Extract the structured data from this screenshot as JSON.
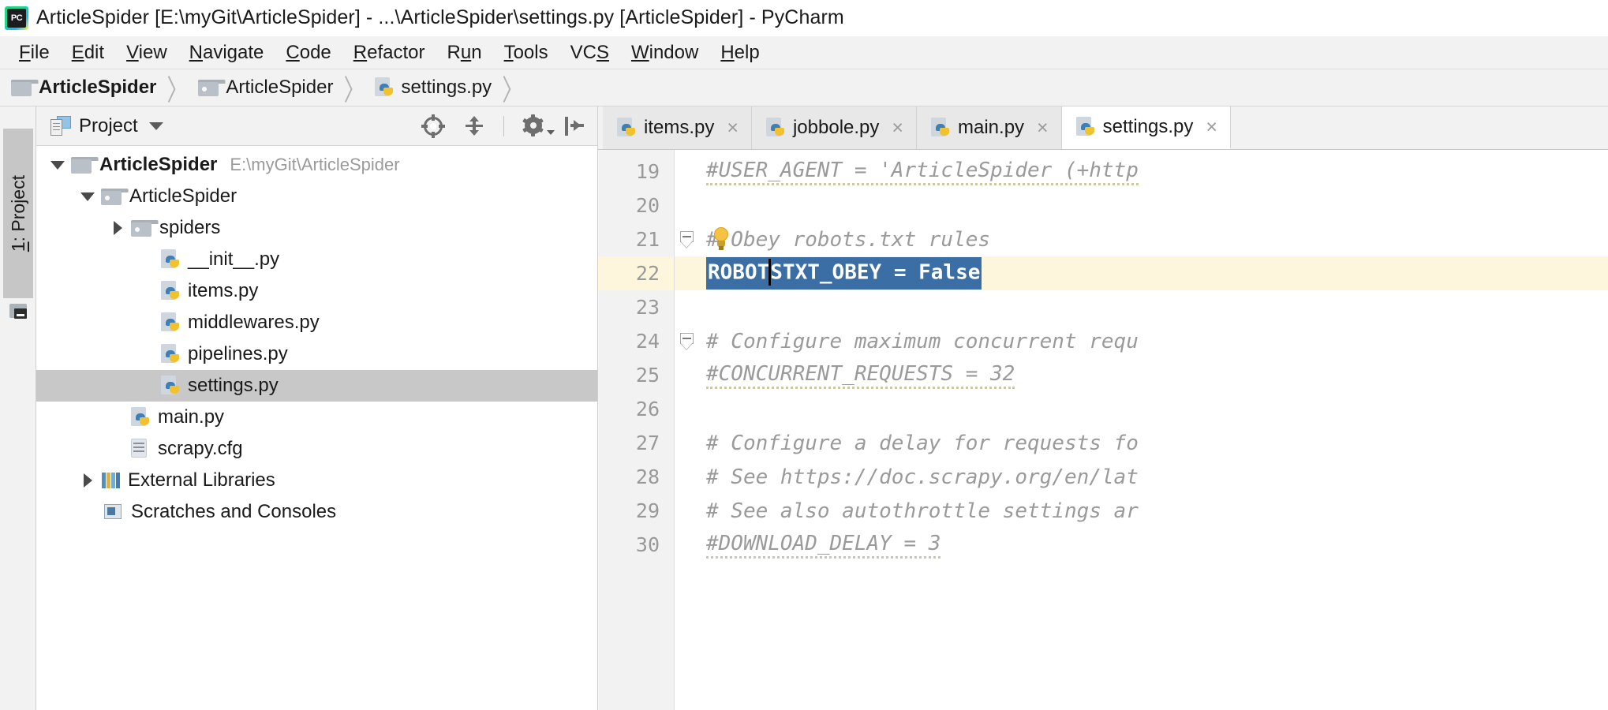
{
  "window": {
    "title": "ArticleSpider [E:\\myGit\\ArticleSpider] - ...\\ArticleSpider\\settings.py [ArticleSpider] - PyCharm",
    "app_icon": "pycharm-logo-icon",
    "logo_text": "PC"
  },
  "menubar": {
    "items": [
      {
        "label": "File",
        "mnemonic": "F"
      },
      {
        "label": "Edit",
        "mnemonic": "E"
      },
      {
        "label": "View",
        "mnemonic": "V"
      },
      {
        "label": "Navigate",
        "mnemonic": "N"
      },
      {
        "label": "Code",
        "mnemonic": "C"
      },
      {
        "label": "Refactor",
        "mnemonic": "R"
      },
      {
        "label": "Run",
        "mnemonic": "u"
      },
      {
        "label": "Tools",
        "mnemonic": "T"
      },
      {
        "label": "VCS",
        "mnemonic": "S"
      },
      {
        "label": "Window",
        "mnemonic": "W"
      },
      {
        "label": "Help",
        "mnemonic": "H"
      }
    ]
  },
  "breadcrumb": {
    "separator": "〉",
    "items": [
      {
        "label": "ArticleSpider",
        "icon": "folder-icon",
        "bold": true
      },
      {
        "label": "ArticleSpider",
        "icon": "folder-pkg-icon",
        "bold": false
      },
      {
        "label": "settings.py",
        "icon": "python-file-icon",
        "bold": false
      }
    ]
  },
  "left_tool_strip": {
    "button_label": "1: Project",
    "button_mnemonic": "1",
    "terminal_icon": "terminal-icon"
  },
  "project_panel": {
    "title": "Project",
    "title_icon": "project-view-icon",
    "dropdown_icon": "chevron-down-icon",
    "toolbar": [
      {
        "name": "locate-in-tree-icon",
        "tooltip": "Select Opened File"
      },
      {
        "name": "collapse-all-icon",
        "tooltip": "Collapse All"
      },
      {
        "name": "settings-gear-icon",
        "tooltip": "Settings"
      },
      {
        "name": "hide-panel-icon",
        "tooltip": "Hide"
      }
    ],
    "tree": [
      {
        "label": "ArticleSpider",
        "sub": "E:\\myGit\\ArticleSpider",
        "icon": "folder-icon",
        "twisty": "expanded",
        "depth": 0,
        "bold": true,
        "selected": false
      },
      {
        "label": "ArticleSpider",
        "sub": "",
        "icon": "folder-pkg-icon",
        "twisty": "expanded",
        "depth": 1,
        "bold": false,
        "selected": false
      },
      {
        "label": "spiders",
        "sub": "",
        "icon": "folder-pkg-icon",
        "twisty": "collapsed",
        "depth": 2,
        "bold": false,
        "selected": false
      },
      {
        "label": "__init__.py",
        "sub": "",
        "icon": "python-file-icon",
        "twisty": "none",
        "depth": 3,
        "bold": false,
        "selected": false
      },
      {
        "label": "items.py",
        "sub": "",
        "icon": "python-file-icon",
        "twisty": "none",
        "depth": 3,
        "bold": false,
        "selected": false
      },
      {
        "label": "middlewares.py",
        "sub": "",
        "icon": "python-file-icon",
        "twisty": "none",
        "depth": 3,
        "bold": false,
        "selected": false
      },
      {
        "label": "pipelines.py",
        "sub": "",
        "icon": "python-file-icon",
        "twisty": "none",
        "depth": 3,
        "bold": false,
        "selected": false
      },
      {
        "label": "settings.py",
        "sub": "",
        "icon": "python-file-icon",
        "twisty": "none",
        "depth": 3,
        "bold": false,
        "selected": true
      },
      {
        "label": "main.py",
        "sub": "",
        "icon": "python-file-icon",
        "twisty": "none",
        "depth": 2,
        "bold": false,
        "selected": false
      },
      {
        "label": "scrapy.cfg",
        "sub": "",
        "icon": "config-file-icon",
        "twisty": "none",
        "depth": 2,
        "bold": false,
        "selected": false
      },
      {
        "label": "External Libraries",
        "sub": "",
        "icon": "libraries-icon",
        "twisty": "collapsed",
        "depth": 1,
        "bold": false,
        "selected": false
      },
      {
        "label": "Scratches and Consoles",
        "sub": "",
        "icon": "scratches-icon",
        "twisty": "none",
        "depth": 1,
        "bold": false,
        "selected": false
      }
    ]
  },
  "editor": {
    "tabs": [
      {
        "label": "items.py",
        "icon": "python-file-icon",
        "active": false,
        "close": "×"
      },
      {
        "label": "jobbole.py",
        "icon": "python-file-icon",
        "active": false,
        "close": "×"
      },
      {
        "label": "main.py",
        "icon": "python-file-icon",
        "active": false,
        "close": "×"
      },
      {
        "label": "settings.py",
        "icon": "python-file-icon",
        "active": true,
        "close": "×"
      }
    ],
    "current_line": 22,
    "selection": {
      "text": "ROBOTSTXT_OBEY = False",
      "caret_after": "ROBOT",
      "color": "#3a6ea5"
    },
    "lines": [
      {
        "num": 19,
        "text": "#USER_AGENT = 'ArticleSpider (+http",
        "style": "comment",
        "squiggly": true,
        "fold": "none",
        "current": false
      },
      {
        "num": 20,
        "text": "",
        "style": "plain",
        "squiggly": false,
        "fold": "none",
        "current": false
      },
      {
        "num": 21,
        "text": "# Obey robots.txt rules",
        "style": "comment",
        "squiggly": false,
        "fold": "collapsible",
        "current": false,
        "bulb": true
      },
      {
        "num": 22,
        "text": "ROBOTSTXT_OBEY = False",
        "style": "selected",
        "squiggly": true,
        "fold": "none",
        "current": true
      },
      {
        "num": 23,
        "text": "",
        "style": "plain",
        "squiggly": false,
        "fold": "none",
        "current": false
      },
      {
        "num": 24,
        "text": "# Configure maximum concurrent requ",
        "style": "comment",
        "squiggly": false,
        "fold": "collapsible",
        "current": false
      },
      {
        "num": 25,
        "text": "#CONCURRENT_REQUESTS = 32",
        "style": "comment",
        "squiggly": true,
        "fold": "none",
        "current": false
      },
      {
        "num": 26,
        "text": "",
        "style": "plain",
        "squiggly": false,
        "fold": "none",
        "current": false
      },
      {
        "num": 27,
        "text": "# Configure a delay for requests fo",
        "style": "comment",
        "squiggly": false,
        "fold": "none",
        "current": false
      },
      {
        "num": 28,
        "text": "# See https://doc.scrapy.org/en/lat",
        "style": "comment",
        "squiggly": false,
        "fold": "none",
        "current": false
      },
      {
        "num": 29,
        "text": "# See also autothrottle settings ar",
        "style": "comment",
        "squiggly": false,
        "fold": "none",
        "current": false
      },
      {
        "num": 30,
        "text": "#DOWNLOAD_DELAY = 3",
        "style": "comment",
        "squiggly": true,
        "fold": "none",
        "current": false
      }
    ]
  },
  "colors": {
    "accent_selection": "#3a6ea5",
    "current_line": "#fdf6dd",
    "comment": "#9a9a9a",
    "panel_bg": "#f2f2f2",
    "tree_selected": "#c8c8c8"
  }
}
